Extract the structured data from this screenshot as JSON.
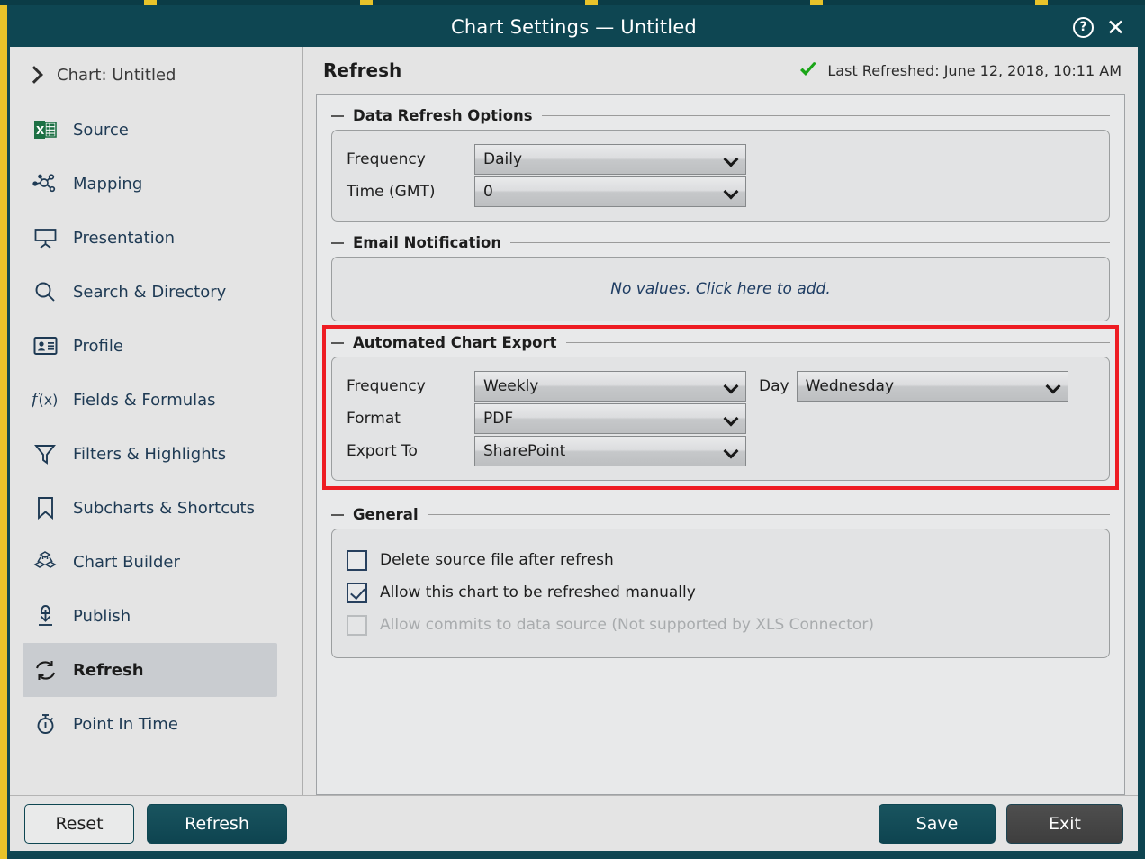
{
  "window": {
    "title": "Chart Settings — Untitled",
    "help_icon": "help-circle-icon",
    "close_icon": "close-icon",
    "accent_teal": "#0e4652",
    "highlight_red": "#ee1c23"
  },
  "sidebar": {
    "chart_header": "Chart: Untitled",
    "items": [
      {
        "label": "Source",
        "icon": "excel-file-icon"
      },
      {
        "label": "Mapping",
        "icon": "node-graph-icon"
      },
      {
        "label": "Presentation",
        "icon": "projector-screen-icon"
      },
      {
        "label": "Search & Directory",
        "icon": "magnifier-icon"
      },
      {
        "label": "Profile",
        "icon": "id-card-icon"
      },
      {
        "label": "Fields & Formulas",
        "icon": "function-fx-icon"
      },
      {
        "label": "Filters & Highlights",
        "icon": "funnel-icon"
      },
      {
        "label": "Subcharts & Shortcuts",
        "icon": "bookmark-icon"
      },
      {
        "label": "Chart Builder",
        "icon": "cubes-icon"
      },
      {
        "label": "Publish",
        "icon": "publish-download-icon"
      },
      {
        "label": "Refresh",
        "icon": "refresh-cycle-icon",
        "active": true
      },
      {
        "label": "Point In Time",
        "icon": "stopwatch-icon"
      }
    ]
  },
  "content": {
    "page_title": "Refresh",
    "status": {
      "icon": "green-check-icon",
      "text": "Last Refreshed: June 12, 2018, 10:11 AM"
    },
    "data_refresh": {
      "legend": "Data Refresh Options",
      "frequency_label": "Frequency",
      "frequency_value": "Daily",
      "time_label": "Time (GMT)",
      "time_value": "0"
    },
    "email_notification": {
      "legend": "Email Notification",
      "empty_text": "No values. Click here to add."
    },
    "automated_export": {
      "legend": "Automated Chart Export",
      "highlighted": true,
      "frequency_label": "Frequency",
      "frequency_value": "Weekly",
      "day_label": "Day",
      "day_value": "Wednesday",
      "format_label": "Format",
      "format_value": "PDF",
      "export_to_label": "Export To",
      "export_to_value": "SharePoint"
    },
    "general": {
      "legend": "General",
      "checkboxes": [
        {
          "label": "Delete source file after refresh",
          "checked": false,
          "disabled": false
        },
        {
          "label": "Allow this chart to be refreshed manually",
          "checked": true,
          "disabled": false
        },
        {
          "label": "Allow commits to data source (Not supported by XLS Connector)",
          "checked": false,
          "disabled": true
        }
      ]
    }
  },
  "footer": {
    "reset_label": "Reset",
    "refresh_label": "Refresh",
    "save_label": "Save",
    "exit_label": "Exit"
  }
}
